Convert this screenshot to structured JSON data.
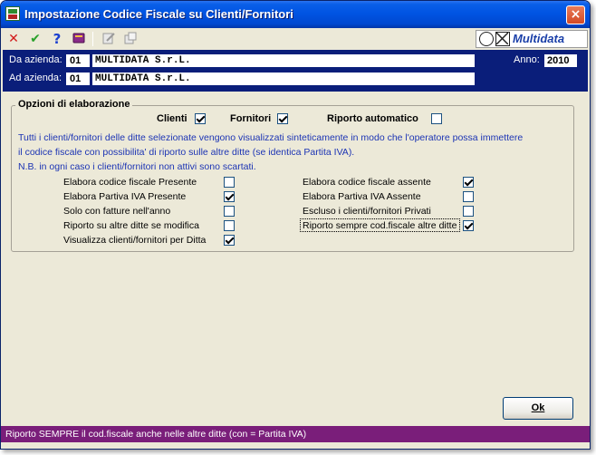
{
  "window": {
    "title": "Impostazione Codice Fiscale su Clienti/Fornitori",
    "close_glyph": "×"
  },
  "toolbar": {
    "icons": [
      "cancel-icon",
      "confirm-icon",
      "help-icon",
      "book-icon",
      "edit-icon",
      "copy-icon"
    ],
    "brand_text": "Multidata"
  },
  "header": {
    "da_azienda_label": "Da azienda:",
    "da_azienda_code": "01",
    "da_azienda_name": "MULTIDATA S.r.L.",
    "ad_azienda_label": "Ad azienda:",
    "ad_azienda_code": "01",
    "ad_azienda_name": "MULTIDATA S.r.L.",
    "anno_label": "Anno:",
    "anno_value": "2010"
  },
  "options": {
    "legend": "Opzioni di elaborazione",
    "clienti_label": "Clienti",
    "clienti_checked": true,
    "fornitori_label": "Fornitori",
    "fornitori_checked": true,
    "riporto_label": "Riporto automatico",
    "riporto_checked": false,
    "info_line1": "Tutti i clienti/fornitori delle ditte selezionate vengono visualizzati sinteticamente in modo che l'operatore possa immettere",
    "info_line2": "il codice fiscale con possibilita' di riporto sulle altre ditte (se identica Partita IVA).",
    "info_line3": "N.B. in ogni caso i clienti/fornitori non attivi sono scartati.",
    "left": [
      {
        "label": "Elabora codice fiscale Presente",
        "checked": false
      },
      {
        "label": "Elabora Partiva IVA Presente",
        "checked": true
      },
      {
        "label": "Solo con fatture nell'anno",
        "checked": false
      },
      {
        "label": "Riporto su altre ditte se modifica",
        "checked": false
      },
      {
        "label": "Visualizza clienti/fornitori per Ditta",
        "checked": true
      }
    ],
    "right": [
      {
        "label": "Elabora codice fiscale assente",
        "checked": true
      },
      {
        "label": "Elabora Partiva IVA Assente",
        "checked": false
      },
      {
        "label": "Escluso i clienti/fornitori Privati",
        "checked": false
      },
      {
        "label": "Riporto sempre cod.fiscale altre ditte",
        "checked": true
      }
    ]
  },
  "buttons": {
    "ok_label": "Ok"
  },
  "status": {
    "text": "Riporto SEMPRE il cod.fiscale anche nelle altre ditte (con = Partita IVA)"
  },
  "colors": {
    "header_bg": "#0a1e7a",
    "status_bg": "#7a1e7a",
    "info_text": "#1c34b4"
  }
}
